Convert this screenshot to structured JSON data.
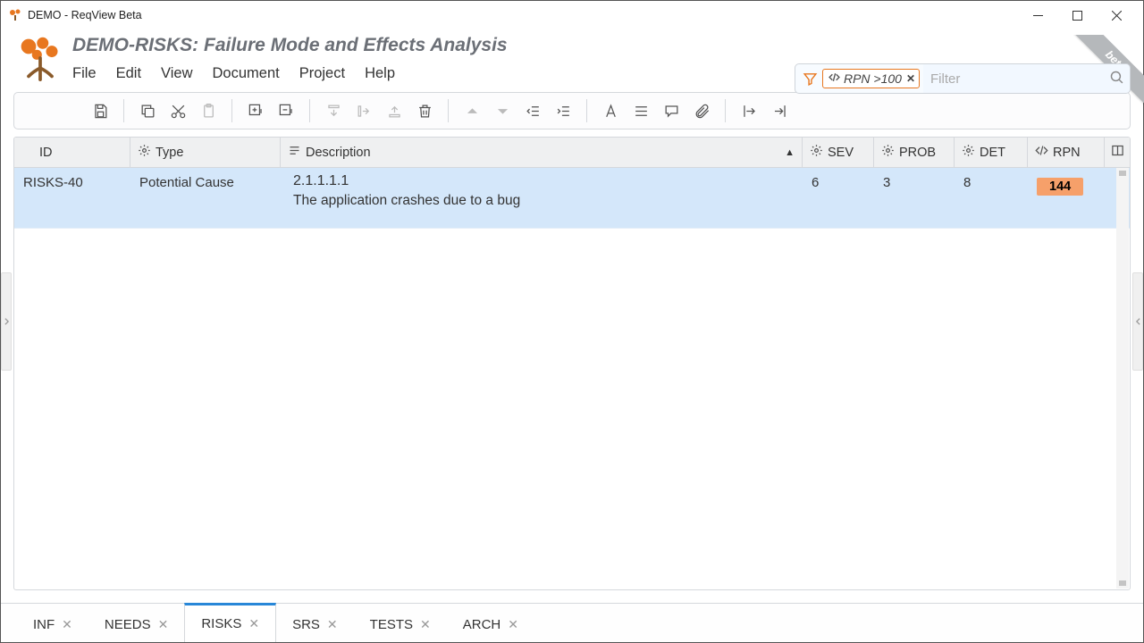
{
  "window": {
    "title": "DEMO - ReqView Beta",
    "beta_label": "beta"
  },
  "header": {
    "doc_title": "DEMO-RISKS: Failure Mode and Effects Analysis",
    "menu": {
      "file": "File",
      "edit": "Edit",
      "view": "View",
      "document": "Document",
      "project": "Project",
      "help": "Help"
    },
    "filter_chip": "RPN >100",
    "filter_placeholder": "Filter"
  },
  "columns": {
    "id": "ID",
    "type": "Type",
    "description": "Description",
    "sev": "SEV",
    "prob": "PROB",
    "det": "DET",
    "rpn": "RPN"
  },
  "rows": [
    {
      "id": "RISKS-40",
      "type": "Potential Cause",
      "section": "2.1.1.1.1",
      "description": "The application crashes due to a bug",
      "sev": "6",
      "prob": "3",
      "det": "8",
      "rpn": "144"
    }
  ],
  "tabs": {
    "inf": "INF",
    "needs": "NEEDS",
    "risks": "RISKS",
    "srs": "SRS",
    "tests": "TESTS",
    "arch": "ARCH"
  }
}
